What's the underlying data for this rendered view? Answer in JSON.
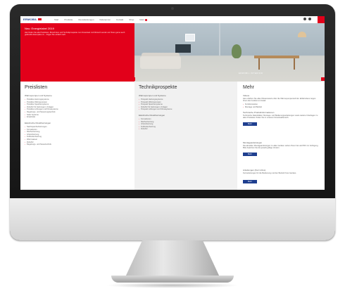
{
  "site": {
    "logo": "ERMOBIL",
    "nav": [
      "Start",
      "Produkte",
      "Dienstleistungen",
      "Referenzen",
      "Kontakt",
      "Shop",
      "Mehr"
    ]
  },
  "hero": {
    "title": "Neu: Energielabel 2019",
    "text": "Hier finden Sie alle Preislisten, Broschüren und Technikprospekte zum Download. Auf Wunsch senden wir Ihnen gerne auch gedruckte Exemplare zu – fragen Sie einfach nach.",
    "caption": "ERMOBIL INTERIOR"
  },
  "columns": {
    "preislisten": {
      "title": "Preislisten",
      "group1": "Wärmepumpen und Systeme",
      "items1": [
        "Preisliste Heizungssysteme",
        "Preisliste Wärmepumpen",
        "Preisliste Speichersysteme",
        "Zubehör für Heizungen / Anlagen",
        "Preisliste Lüftungen und Klimasysteme",
        "Regelungs- und Steuerungstechnik",
        "Solar Systeme",
        "Ersatzteile"
      ],
      "group2": "Elektrische Direktheizungen",
      "items2": [
        "Nachtspeicherheizungen",
        "Konvektoren",
        "Flächenheizung",
        "Infrarotheizung",
        "Fußbodenheizung",
        "Warmwasser",
        "Zubehör",
        "Regelungs- und Steuertechnik"
      ]
    },
    "technik": {
      "title": "Technikprospekte",
      "group1": "Wärmepumpen und Systeme",
      "items1": [
        "Prospekt Heizungssysteme",
        "Prospekt Wärmepumpen",
        "Prospekt Speichersysteme",
        "Zubehör für Heizungen / Anlagen",
        "Prospekt Lüftungen und Klimasysteme"
      ],
      "group2": "Elektrische Direktheizungen",
      "items2": [
        "Konvektoren",
        "Flächenheizung",
        "Infrarotheizung",
        "Fußbodenheizung",
        "Zubehör"
      ]
    },
    "mehr": {
      "title": "Mehr",
      "s1_head": "Videos",
      "s1_text": "Hier erfahren Sie alles Wissenswerte über die Wärmepumpentechnik. Erklärvideos zeigen Ihnen die Funktion im Detail.",
      "s1_items": [
        "Funktionsweise",
        "Montage und Betrieb"
      ],
      "s2_head": "Technische Produktinformationen",
      "s2_text": "Technische Datenblätter, Montage- und Bedienungsanleitungen sowie weitere Unterlagen zu allen Produkten finden Sie in unserem Downloadbereich.",
      "s2_button": "Mehr",
      "s3_head": "Montageanleitungen",
      "s3_text": "Die aktuellen Montageanleitungen zu allen Geräten stehen Ihnen hier als PDF zur Verfügung. Bitte beachten Sie die jeweils gültige Version.",
      "s3_button": "Mehr",
      "s4_head": "Anleitungen (Kurz-Infos)",
      "s4_text": "Kurzanleitungen für die Bedienung und den Betrieb Ihres Gerätes.",
      "s4_button": "Mehr"
    }
  },
  "colors": {
    "accent": "#e2001a",
    "brand": "#1f3f8f"
  }
}
